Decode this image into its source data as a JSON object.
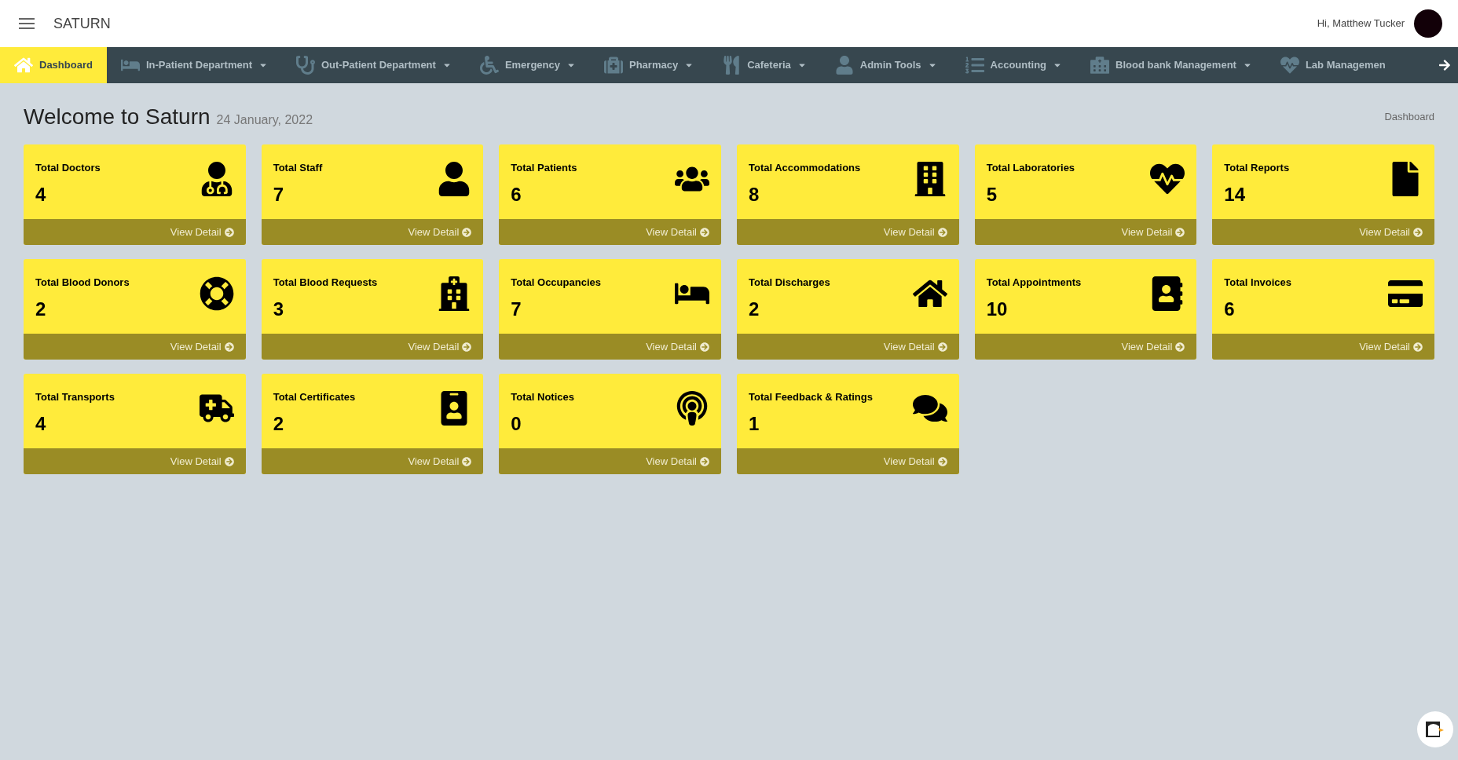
{
  "header": {
    "brand": "SATURN",
    "greeting": "Hi, Matthew Tucker"
  },
  "nav": [
    {
      "label": "Dashboard",
      "selected": true,
      "dropdown": false
    },
    {
      "label": "In-Patient Department",
      "selected": false,
      "dropdown": true
    },
    {
      "label": "Out-Patient Department",
      "selected": false,
      "dropdown": true
    },
    {
      "label": "Emergency",
      "selected": false,
      "dropdown": true
    },
    {
      "label": "Pharmacy",
      "selected": false,
      "dropdown": true
    },
    {
      "label": "Cafeteria",
      "selected": false,
      "dropdown": true
    },
    {
      "label": "Admin Tools",
      "selected": false,
      "dropdown": true
    },
    {
      "label": "Accounting",
      "selected": false,
      "dropdown": true
    },
    {
      "label": "Blood bank Management",
      "selected": false,
      "dropdown": true
    },
    {
      "label": "Lab Managemen",
      "selected": false,
      "dropdown": false
    }
  ],
  "page": {
    "title": "Welcome to Saturn",
    "date": "24 January, 2022",
    "breadcrumb": "Dashboard"
  },
  "cards": [
    {
      "title": "Total Doctors",
      "value": "4",
      "link": "View Detail"
    },
    {
      "title": "Total Staff",
      "value": "7",
      "link": "View Detail"
    },
    {
      "title": "Total Patients",
      "value": "6",
      "link": "View Detail"
    },
    {
      "title": "Total Accommodations",
      "value": "8",
      "link": "View Detail"
    },
    {
      "title": "Total Laboratories",
      "value": "5",
      "link": "View Detail"
    },
    {
      "title": "Total Reports",
      "value": "14",
      "link": "View Detail"
    },
    {
      "title": "Total Blood Donors",
      "value": "2",
      "link": "View Detail"
    },
    {
      "title": "Total Blood Requests",
      "value": "3",
      "link": "View Detail"
    },
    {
      "title": "Total Occupancies",
      "value": "7",
      "link": "View Detail"
    },
    {
      "title": "Total Discharges",
      "value": "2",
      "link": "View Detail"
    },
    {
      "title": "Total Appointments",
      "value": "10",
      "link": "View Detail"
    },
    {
      "title": "Total Invoices",
      "value": "6",
      "link": "View Detail"
    },
    {
      "title": "Total Transports",
      "value": "4",
      "link": "View Detail"
    },
    {
      "title": "Total Certificates",
      "value": "2",
      "link": "View Detail"
    },
    {
      "title": "Total Notices",
      "value": "0",
      "link": "View Detail"
    },
    {
      "title": "Total Feedback & Ratings",
      "value": "1",
      "link": "View Detail"
    }
  ]
}
